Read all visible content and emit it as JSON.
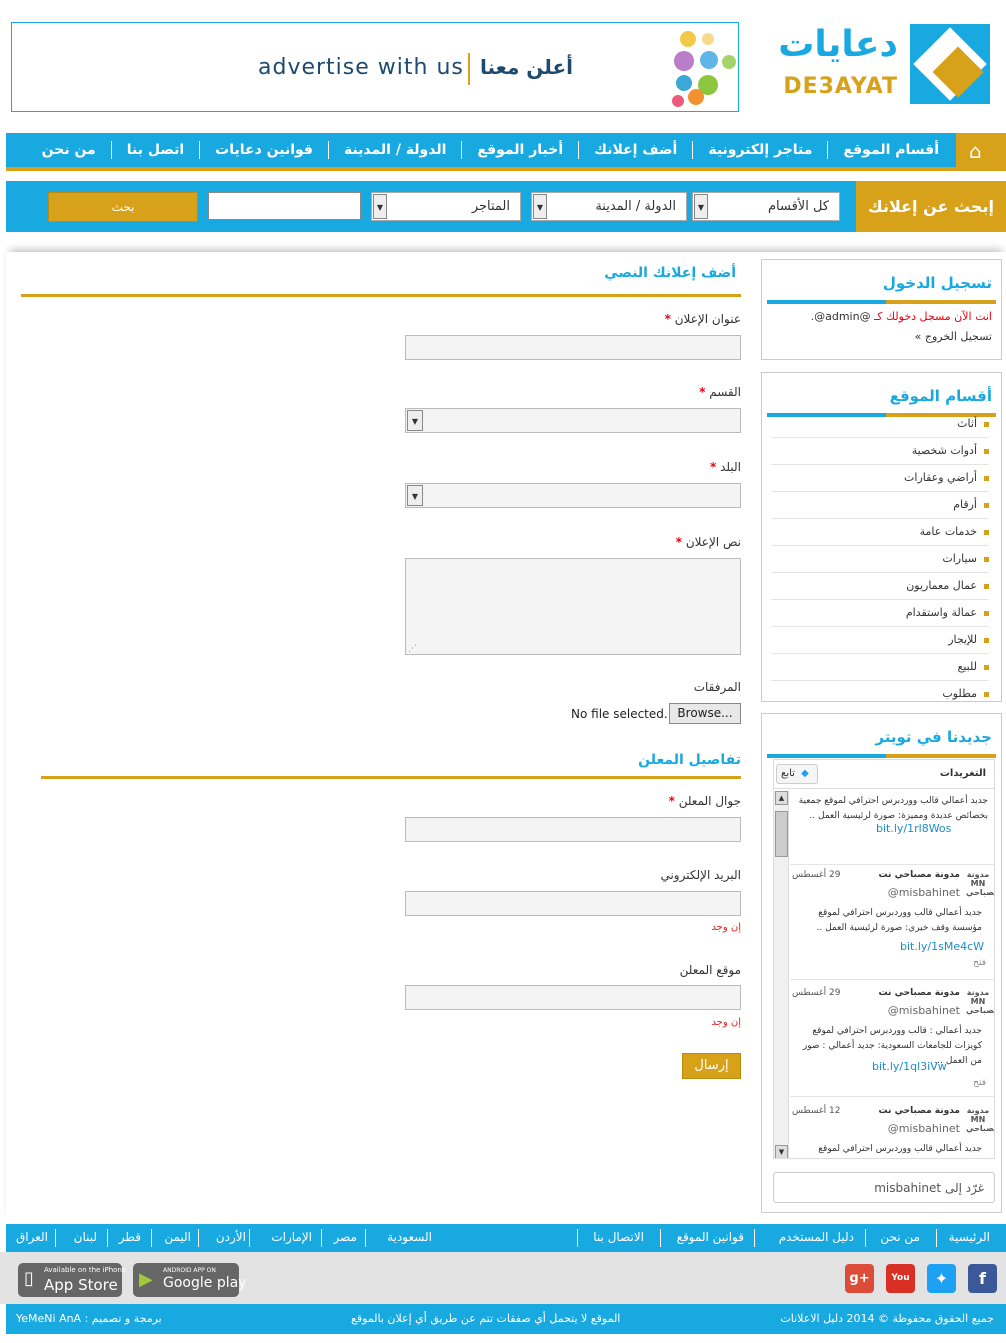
{
  "logo": {
    "ar": "دعايات",
    "en": "DE3AYAT"
  },
  "banner": {
    "en": "advertise with us",
    "ar": "أعلن معنا"
  },
  "nav": {
    "items": [
      "أقسام الموقع",
      "متاجر إلكترونية",
      "أضف إعلانك",
      "أخبار الموقع",
      "الدولة / المدينة",
      "قوانين دعايات",
      "اتصل بنا",
      "من نحن"
    ]
  },
  "search": {
    "title": "إبحث عن إعلانك",
    "category": "كل الأقسام",
    "country": "الدولة / المدينة",
    "stores": "المتاجر",
    "button": "بحث",
    "keyword": ""
  },
  "login": {
    "title": "تسجيل الدخول",
    "status_prefix": "انت الآن مسجل دخولك كـ",
    "user": "@admin@.",
    "logout": "تسجيل الخروج »"
  },
  "sections": {
    "title": "أقسام الموقع",
    "items": [
      "أثاث",
      "أدوات شخصية",
      "أراضي وعقارات",
      "أرقام",
      "خدمات عامة",
      "سيارات",
      "عمال معماريون",
      "عمالة واستقدام",
      "للإيجار",
      "للبيع",
      "مطلوب"
    ]
  },
  "twitter": {
    "title": "جديدنا في تويتر",
    "header": "التغريدات",
    "follow": "تابع",
    "tweets": [
      {
        "author": "",
        "handle": "",
        "date": "",
        "text": "جديد أعمالي قالب ووردبرس احترافي لموقع جمعية بخصائص عديدة ومميزة: صورة لرئيسية العمل ..",
        "link": "bit.ly/1rl8Wos",
        "open": ""
      },
      {
        "author": "مدونة مصباحي نت",
        "handle": "@misbahinet",
        "date": "29 أغسطس",
        "text": "جديد أعمالي قالب ووردبرس احترافي لموقع مؤسسة وقف خيري: صورة لرئيسية العمل ..",
        "link": "bit.ly/1sMe4cW",
        "open": "فتح"
      },
      {
        "author": "مدونة مصباحي نت",
        "handle": "@misbahinet",
        "date": "29 أغسطس",
        "text": "جديد أعمالي : قالب ووردبرس احترافي لموقع كويزات للجامعات السعودية: جديد أعمالي : صور من العمل ...",
        "link": "bit.ly/1ql3iVw",
        "open": "فتح"
      },
      {
        "author": "مدونة مصباحي نت",
        "handle": "@misbahinet",
        "date": "12 أغسطس",
        "text": "جديد أعمالي قالب ووردبرس احترافي لموقع",
        "link": "",
        "open": ""
      }
    ],
    "reply_placeholder": "غرّد إلى misbahinet"
  },
  "form": {
    "title": "أضف إعلانك النصي",
    "ad_title": "عنوان الإعلان",
    "category": "القسم",
    "country": "البلد",
    "ad_text": "نص الإعلان",
    "attachments": "المرفقات",
    "browse": "Browse...",
    "no_file": "No file selected.",
    "advertiser_title": "تفاصيل المعلن",
    "mobile": "جوال المعلن",
    "email": "البريد الإلكتروني",
    "if_any": "إن وجد",
    "website": "موقع المعلن",
    "submit": "إرسال",
    "required_mark": "*"
  },
  "footer": {
    "links": [
      "الرئيسية",
      "من نحن",
      "دليل المستخدم",
      "قوانين الموقع",
      "الاتصال بنا"
    ],
    "countries": [
      "السعودية",
      "مصر",
      "الإمارات",
      "الأردن",
      "اليمن",
      "قطر",
      "لبنان",
      "العراق"
    ],
    "app_store": {
      "small": "Available on the iPhone",
      "big": "App Store"
    },
    "google_play": {
      "small": "ANDROID APP ON",
      "big": "Google play"
    },
    "copyright": "جميع الحقوق محفوظة © 2014 دليل الاعلانات",
    "disclaimer": "الموقع لا يتحمل أي صفقات تتم عن طريق أي إعلان بالموقع",
    "credit": "برمجة و تصميم : YeMeNi AnA"
  },
  "colors": {
    "blue": "#19a9e1",
    "gold": "#d8a11a"
  }
}
